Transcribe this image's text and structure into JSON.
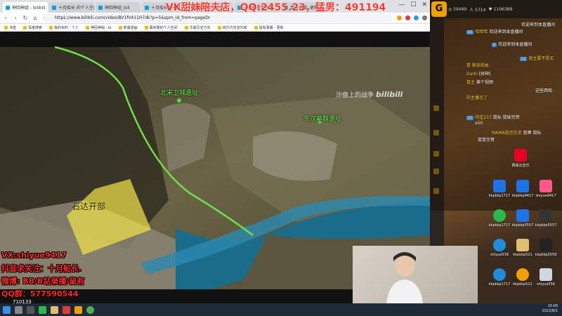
{
  "overlay": {
    "top_text": "VK甜妹陪夫店，QQ:2455.23，猛男：491194",
    "vx": "VX:shiyue9417",
    "douyin": "抖音求关注：十月船长.",
    "weibo": "微博: BB/B站录播/鼠有",
    "qq": "QQ群：577590544",
    "video_number": "710133"
  },
  "browser": {
    "tabs": [
      "神回神组 - bilibili",
      "十月船长 的个人空间",
      "神回神组_bili",
      "十月船长的十月",
      "幕府的个人空间",
      "十月舰长百大赏",
      "鼠有录播 -更新"
    ],
    "url": "https://www.bilibili.com/video/BV1fV411H7dk?p=5&spm_id_from=pageDr",
    "bookmarks": [
      "书签",
      "百度搜索",
      "我的资料 - 个人",
      "神回神组 - bi",
      "新版漫画",
      "幕府量的个人空间",
      "华夏历史万年",
      "戏乐万年音乐库",
      "鼠有录播 - 更新"
    ],
    "nav": {
      "back": "‹",
      "forward": "›",
      "reload": "↻",
      "home": "⌂"
    },
    "window_controls": {
      "min": "—",
      "max": "☐",
      "close": "✕"
    }
  },
  "video": {
    "label_north": "北宋卫城遗址",
    "label_east": "东汉墓群遗址",
    "label_shidazhai": "石达开部",
    "watermark_text": "沙盘上的战争",
    "watermark_logo": "bilibili"
  },
  "chat": {
    "stats": [
      "◎ 59499",
      "人 5714",
      "♥ 1106388"
    ],
    "header_text": "欢迎来到本直播间",
    "messages": [
      {
        "level": "10",
        "user": "哈哈哈",
        "text": "欢迎来到本直播间"
      },
      {
        "level": "8",
        "user": "",
        "text": "欢迎来到本直播间"
      },
      {
        "level": "12",
        "user": "我主要不是买",
        "text": ""
      },
      {
        "level": "",
        "user": "鼠 慈采购本",
        "text": ""
      },
      {
        "level": "",
        "user": "Darki",
        "text": "[财神]"
      },
      {
        "level": "",
        "user": "鼠主",
        "text": "换个视频"
      },
      {
        "level": "",
        "user": "",
        "text": "这些西帕"
      },
      {
        "level": "",
        "user": "的主播也了",
        "text": ""
      },
      {
        "level": "21",
        "user": "待定217",
        "text": "鼠标 鼠妹完哥"
      },
      {
        "level": "",
        "user": "",
        "text": "x50"
      },
      {
        "level": "",
        "user": "MAMA鼠还在说",
        "text": "鼠牌 鼠标"
      },
      {
        "level": "",
        "user": "",
        "text": "鼠鼠完哥"
      }
    ]
  },
  "desktop_icons": [
    {
      "label": "网易云音乐",
      "color": "#e60026"
    },
    {
      "label": "kkpkkp1717",
      "color": "#1e74e6"
    },
    {
      "label": "kkpkkp9417",
      "color": "#1e74e6"
    },
    {
      "label": "shiyue9417",
      "color": "#ff5a8a"
    },
    {
      "label": "kkpkkp1717",
      "color": "#2db84d"
    },
    {
      "label": "kkpkkp5557",
      "color": "#1e74e6"
    },
    {
      "label": "kkpkkp5557",
      "color": "#333333"
    },
    {
      "label": "shiyue539",
      "color": "#1f8ddb"
    },
    {
      "label": "kkpkkp521",
      "color": "#e0c070"
    },
    {
      "label": "kkpkkp5559",
      "color": "#222222"
    },
    {
      "label": "kkpkkp1717",
      "color": "#f0a000"
    },
    {
      "label": "kkpkkp521",
      "color": "#e0c070"
    },
    {
      "label": "shiyue556",
      "color": "#cfd8e0"
    }
  ],
  "tray": {
    "time": "15:00",
    "date": "2022/8/1"
  }
}
